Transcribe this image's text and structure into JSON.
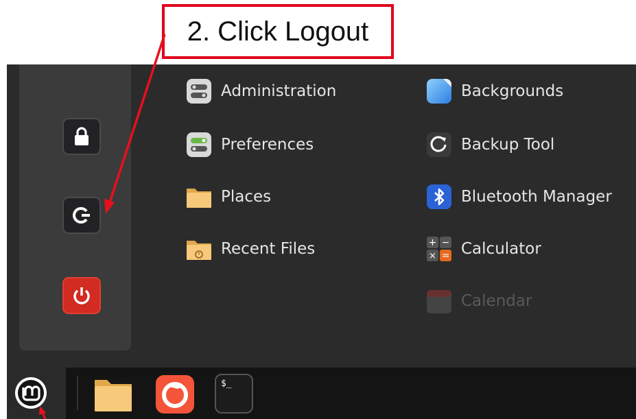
{
  "annotation": {
    "text": "2. Click Logout",
    "color": "#e0001b"
  },
  "side_buttons": [
    {
      "name": "lock-screen-button",
      "icon": "lock-icon"
    },
    {
      "name": "logout-button",
      "icon": "logout-icon"
    },
    {
      "name": "shutdown-button",
      "icon": "power-icon"
    }
  ],
  "categories": [
    {
      "label": "Administration",
      "icon": "administration-icon"
    },
    {
      "label": "Preferences",
      "icon": "preferences-icon"
    },
    {
      "label": "Places",
      "icon": "folder-icon"
    },
    {
      "label": "Recent Files",
      "icon": "recent-files-icon"
    }
  ],
  "apps": [
    {
      "label": "Backgrounds",
      "icon": "backgrounds-icon"
    },
    {
      "label": "Backup Tool",
      "icon": "backup-tool-icon"
    },
    {
      "label": "Bluetooth Manager",
      "icon": "bluetooth-icon"
    },
    {
      "label": "Calculator",
      "icon": "calculator-icon"
    },
    {
      "label": "Calendar",
      "icon": "calendar-icon"
    }
  ],
  "taskbar": [
    {
      "name": "mint-menu-button",
      "icon": "linux-mint-logo-icon"
    },
    {
      "name": "files-launcher",
      "icon": "folder-icon"
    },
    {
      "name": "firefox-launcher",
      "icon": "firefox-icon"
    },
    {
      "name": "terminal-launcher",
      "icon": "terminal-icon"
    }
  ],
  "terminal_prompt": "$_",
  "colors": {
    "menu_bg": "#2b2b2b",
    "sidebar_bg": "#3b3b3b",
    "taskbar_bg": "#141414",
    "accent_red": "#d12b22"
  }
}
